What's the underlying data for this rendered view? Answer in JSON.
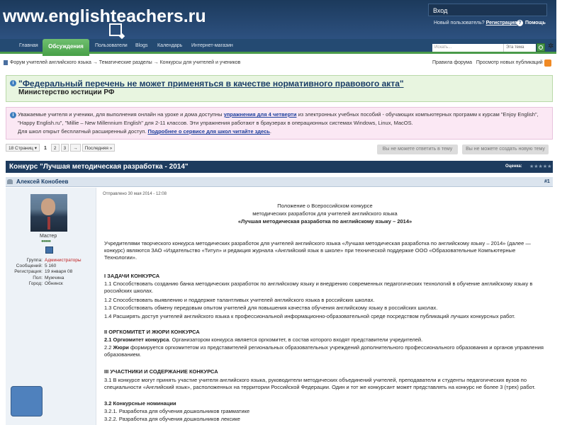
{
  "header": {
    "logo_text": "www.englishteachers.ru",
    "login_placeholder": "Вход",
    "new_user_text": "Новый пользователь?",
    "register_label": "Регистрация",
    "help_label": "Помощь"
  },
  "nav": {
    "items": [
      "Главная",
      "Обсуждения",
      "Пользователи",
      "Blogs",
      "Календарь",
      "Интернет-магазин"
    ],
    "active": "Обсуждения",
    "search_placeholder": "Искать...",
    "search_scope": "Эта тема"
  },
  "breadcrumb": {
    "items": [
      "Форум учителей английского языка",
      "Тематические разделы",
      "Конкурсы для учителей и учеников"
    ],
    "links": [
      "Правила форума",
      "Просмотр новых публикаций"
    ]
  },
  "notice1": {
    "title": "\"Федеральный перечень не может применяться в качестве нормативного правового акта\"",
    "subtitle": "Министерство юстиции РФ"
  },
  "notice2": {
    "line1_pre": "Уважаемые учителя и ученики, для выполнения онлайн на уроке и дома доступны",
    "line1_link": "упражнения для 4 четверти",
    "line1_post": "из электронных учебных пособий - обучающих компьютерных программ к курсам \"Enjoy English\",",
    "line2": "\"Happy English.ru\", \"Millie – New Millennium English\" для 2-11 классов. Эти упражнения работают в браузерах в операционных системах Windows, Linux, MacOS.",
    "line3_pre": "Для школ открыт бесплатный расширенный доступ.",
    "line3_link": "Подробнее о сервисе для школ читайте здесь"
  },
  "pagination": {
    "pages_label": "18 Страниц",
    "pages": [
      "1",
      "2",
      "3",
      "→"
    ],
    "last": "Последняя »",
    "cannot_reply": "Вы не можете ответить в тему",
    "cannot_create": "Вы не можете создать новую тему"
  },
  "thread": {
    "title": "Конкурс \"Лучшая методическая разработка - 2014\"",
    "rating_label": "Оценка:",
    "stars": "★★★★★"
  },
  "post": {
    "author": "Алексей Конобеев",
    "number": "#1",
    "posted": "Отправлено 30 мая 2014 - 12:08",
    "user": {
      "rank": "Мастер",
      "reputation": "●●●●●",
      "fields": [
        {
          "label": "Группа:",
          "value": "Администраторы"
        },
        {
          "label": "Сообщений:",
          "value": "5 160"
        },
        {
          "label": "Регистрация:",
          "value": "19 января 08"
        },
        {
          "label": "Пол:",
          "value": "Мужчина"
        },
        {
          "label": "Город:",
          "value": "Обнинск"
        }
      ]
    },
    "body": {
      "title1": "Положение о Всероссийском конкурсе",
      "title2": "методических разработок для учителей английского языка",
      "title3": "«Лучшая методическая разработка по английскому языку – 2014»",
      "intro": "Учредителями творческого конкурса методических разработок для учителей английского языка «Лучшая методическая разработка по английскому языку – 2014» (далее — конкурс) являются ЗАО «Издательство «Титул» и редакция журнала «Английский язык в школе» при технической поддержке ООО «Образовательные Компьютерные Технологии».",
      "s1_title": "I ЗАДАЧИ КОНКУРСА",
      "s1_p1": "1.1 Способствовать созданию банка методических разработок по английскому языку и внедрению современных педагогических технологий в обучение английскому языку в российских школах.",
      "s1_p2": "1.2 Способствовать выявлению и поддержке талантливых учителей английского языка в российских школах.",
      "s1_p3": "1.3 Способствовать обмену передовым опытом учителей для повышения качества обучения английскому языку в российских школах.",
      "s1_p4": "1.4 Расширять доступ учителей английского языка к профессиональной информационно-образовательной среде посредством публикаций лучших конкурсных работ.",
      "s2_title": "II ОРГКОМИТЕТ И ЖЮРИ КОНКУРСА",
      "s2_p1_bold": "2.1 Оргкомитет конкурса",
      "s2_p1_rest": ". Организатором конкурса является оргкомитет, в состав которого входят представители учредителей.",
      "s2_p2_pre": "2.2 ",
      "s2_p2_bold": "Жюри",
      "s2_p2_rest": " формируется оргкомитетом из представителей региональных образовательных учреждений дополнительного профессионального образования и органов управления образованием.",
      "s3_title": "III УЧАСТНИКИ И СОДЕРЖАНИЕ КОНКУРСА",
      "s3_p1": "3.1 В конкурсе могут принять участие учителя английского языка, руководители методических объединений учителей, преподаватели и студенты педагогических вузов по специальности «Английский язык», расположенных на территории Российской Федерации. Один и тот же конкурсант может представлять на конкурс не более 3 (трех) работ.",
      "s3_2_title": "3.2 Конкурсные номинации",
      "s3_2_1": "3.2.1. Разработка для обучения дошкольников грамматике",
      "s3_2_2": "3.2.2. Разработка для обучения дошкольников лексике"
    }
  }
}
